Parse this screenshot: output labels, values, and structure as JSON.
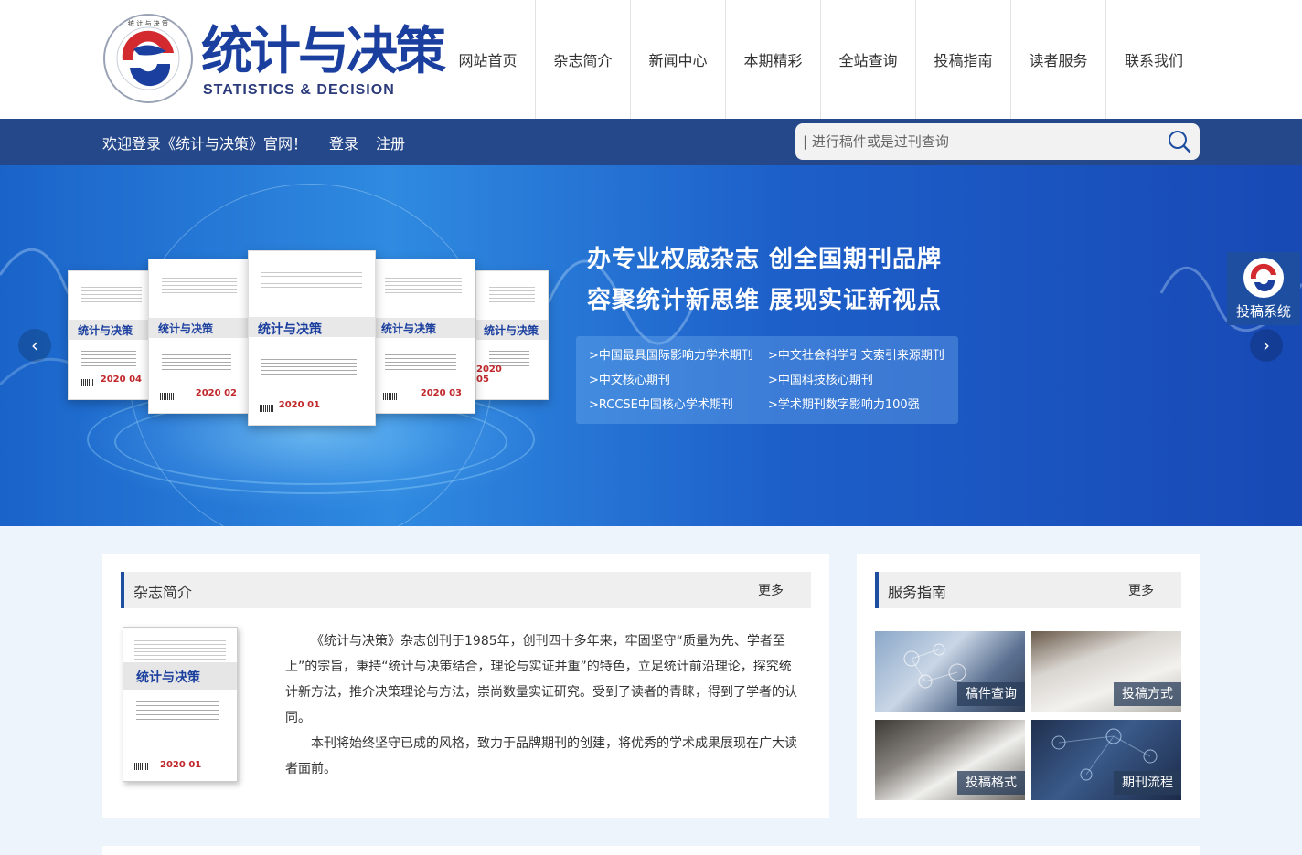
{
  "logo": {
    "cn": "统计与决策",
    "en": "STATISTICS & DECISION"
  },
  "nav": [
    "网站首页",
    "杂志简介",
    "新闻中心",
    "本期精彩",
    "全站查询",
    "投稿指南",
    "读者服务",
    "联系我们"
  ],
  "topbar": {
    "welcome": "欢迎登录《统计与决策》官网！",
    "login": "登录",
    "register": "注册",
    "search_placeholder": "| 进行稿件或是过刊查询"
  },
  "banner": {
    "slogan_1": "办专业权威杂志 创全国期刊品牌",
    "slogan_2": "容聚统计新思维 展现实证新视点",
    "tags": [
      ">中国最具国际影响力学术期刊",
      ">中文社会科学引文索引来源期刊",
      ">中文核心期刊",
      ">中国科技核心期刊",
      ">RCCSE中国核心学术期刊",
      ">学术期刊数字影响力100强"
    ],
    "covers": [
      {
        "logo": "统计与决策",
        "year": "2020 04"
      },
      {
        "logo": "统计与决策",
        "year": "2020 02"
      },
      {
        "logo": "统计与决策",
        "year": "2020 01"
      },
      {
        "logo": "统计与决策",
        "year": "2020 03"
      },
      {
        "logo": "统计与决策",
        "year": "2020 05"
      }
    ],
    "prev_icon": "chevron-left-icon",
    "next_icon": "chevron-right-icon"
  },
  "submit_system": {
    "label": "投稿系统",
    "icon": "journal-emblem-icon"
  },
  "intro_panel": {
    "title": "杂志简介",
    "more": "更多",
    "cover_logo": "统计与决策",
    "cover_year": "2020 01",
    "paragraph_1": "《统计与决策》杂志创刊于1985年，创刊四十多年来，牢固坚守“质量为先、学者至上”的宗旨，秉持“统计与决策结合，理论与实证并重”的特色，立足统计前沿理论，探究统计新方法，推介决策理论与方法，崇尚数量实证研究。受到了读者的青睐，得到了学者的认同。",
    "paragraph_2": "本刊将始终坚守已成的风格，致力于品牌期刊的创建，将优秀的学术成果展现在广大读者面前。"
  },
  "service_panel": {
    "title": "服务指南",
    "more": "更多",
    "items": [
      "稿件查询",
      "投稿方式",
      "投稿格式",
      "期刊流程"
    ]
  },
  "colors": {
    "brand": "#1d4e9f",
    "topbar": "#25488a",
    "accent_red": "#c0282c"
  }
}
